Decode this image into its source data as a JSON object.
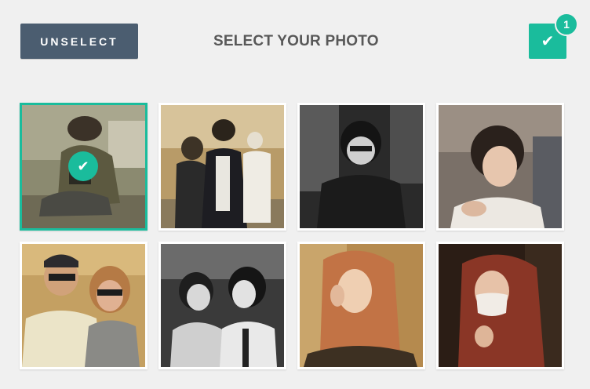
{
  "toolbar": {
    "unselect_label": "UNSELECT",
    "title": "SELECT YOUR PHOTO",
    "confirm_icon": "check-icon",
    "confirm_glyph": "✔",
    "selected_count": "1"
  },
  "colors": {
    "accent": "#1abc9c",
    "button_dark": "#4b5d70",
    "background": "#f0f0f0",
    "title_text": "#585858"
  },
  "photos": [
    {
      "selected": true,
      "selected_glyph": "✔"
    },
    {
      "selected": false
    },
    {
      "selected": false
    },
    {
      "selected": false
    },
    {
      "selected": false
    },
    {
      "selected": false
    },
    {
      "selected": false
    },
    {
      "selected": false
    }
  ]
}
